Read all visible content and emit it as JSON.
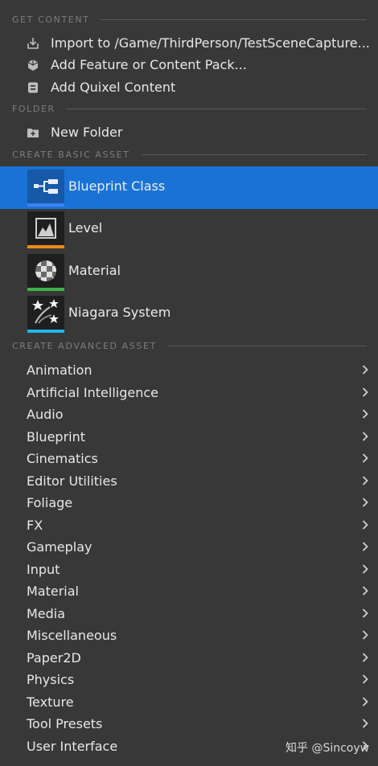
{
  "sections": {
    "get_content": "GET CONTENT",
    "folder": "FOLDER",
    "create_basic_asset": "CREATE BASIC ASSET",
    "create_advanced_asset": "CREATE ADVANCED ASSET"
  },
  "get_content_items": [
    {
      "label": "Import to /Game/ThirdPerson/TestSceneCapture...",
      "icon": "import-icon"
    },
    {
      "label": "Add Feature or Content Pack...",
      "icon": "content-pack-icon"
    },
    {
      "label": "Add Quixel Content",
      "icon": "quixel-icon"
    }
  ],
  "folder_items": [
    {
      "label": "New Folder",
      "icon": "new-folder-icon"
    }
  ],
  "basic_assets": [
    {
      "label": "Blueprint Class",
      "icon": "blueprint-class-icon",
      "accent": "#3b82f6",
      "selected": true
    },
    {
      "label": "Level",
      "icon": "level-icon",
      "accent": "#e8891c",
      "selected": false
    },
    {
      "label": "Material",
      "icon": "material-icon",
      "accent": "#3fb348",
      "selected": false
    },
    {
      "label": "Niagara System",
      "icon": "niagara-system-icon",
      "accent": "#20b6e8",
      "selected": false
    }
  ],
  "advanced_assets": [
    "Animation",
    "Artificial Intelligence",
    "Audio",
    "Blueprint",
    "Cinematics",
    "Editor Utilities",
    "Foliage",
    "FX",
    "Gameplay",
    "Input",
    "Material",
    "Media",
    "Miscellaneous",
    "Paper2D",
    "Physics",
    "Texture",
    "Tool Presets",
    "User Interface"
  ],
  "watermark": "知乎 @Sincoyw",
  "colors": {
    "background": "#383838",
    "selection": "#1a73d4",
    "section_text": "#7d7d7d",
    "item_text": "#e8e8e8"
  }
}
